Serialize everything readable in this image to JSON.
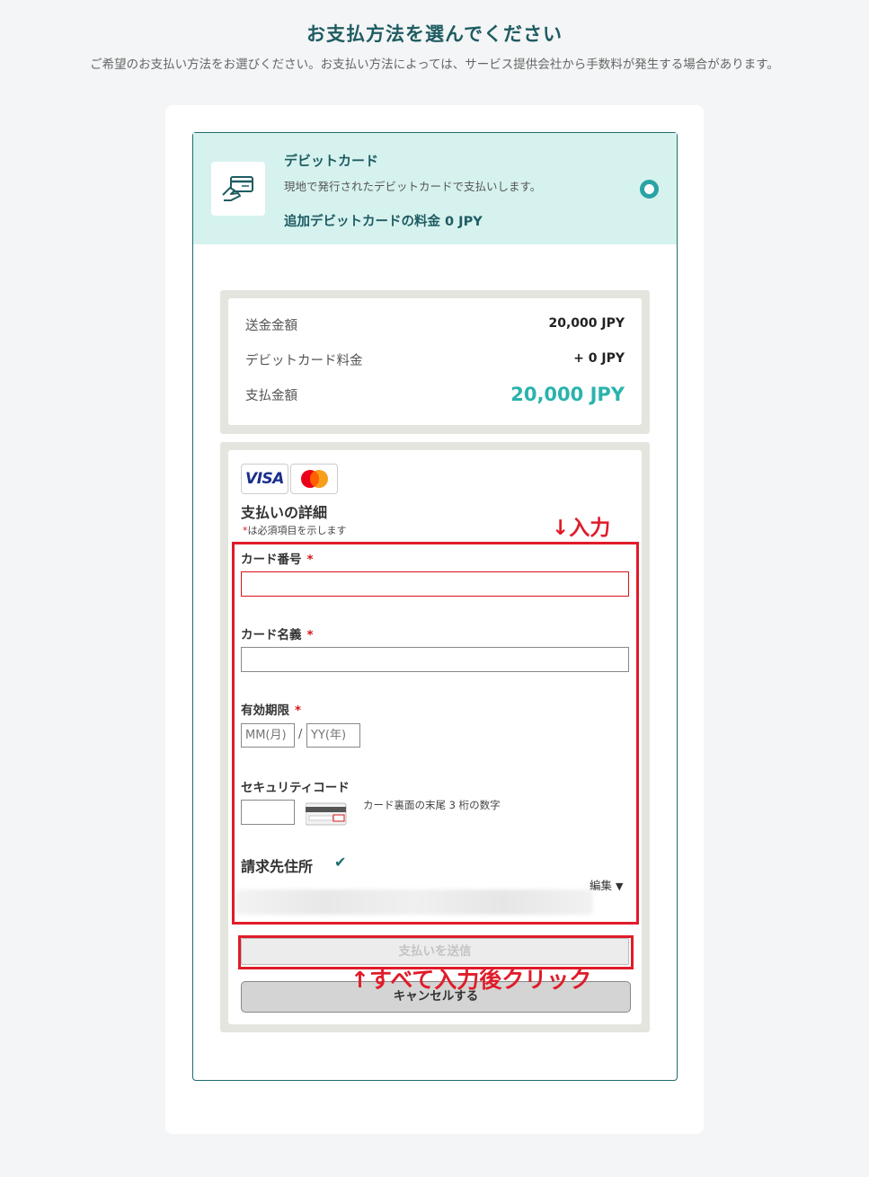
{
  "page": {
    "title": "お支払方法を選んでください",
    "subtitle": "ご希望のお支払い方法をお選びください。お支払い方法によっては、サービス提供会社から手数料が発生する場合があります。"
  },
  "method": {
    "name": "デビットカード",
    "description": "現地で発行されたデビットカードで支払いします。",
    "fee": "追加デビットカードの料金 0 JPY",
    "icon": "card-in-hand-icon"
  },
  "summary": {
    "rows": [
      {
        "label": "送金金額",
        "value": "20,000 JPY"
      },
      {
        "label": "デビットカード料金",
        "value": "+ 0 JPY"
      },
      {
        "label": "支払金額",
        "value": "20,000 JPY"
      }
    ],
    "total_color": "#2ab3ad"
  },
  "form": {
    "brands": [
      "VISA",
      "mastercard"
    ],
    "title": "支払いの詳細",
    "required_star": "*",
    "required_note": "は必須項目を示します",
    "card_number_label": "カード番号",
    "card_name_label": "カード名義",
    "expiry_label": "有効期限",
    "month_placeholder": "MM(月)",
    "year_placeholder": "YY(年)",
    "expiry_separator": "/",
    "security_label": "セキュリティコード",
    "security_hint": "カード裏面の末尾 3 桁の数字",
    "billing_label": "請求先住所",
    "edit_label": "編集",
    "submit_label": "支払いを送信",
    "cancel_label": "キャンセルする"
  },
  "annotations": {
    "input_hint": "↓入力",
    "click_hint": "↑すべて入力後クリック",
    "color": "#e01c2a"
  },
  "colors": {
    "accent": "#1e5c62",
    "header_bg": "#d6f2ef",
    "radio": "#2aa3a3"
  }
}
